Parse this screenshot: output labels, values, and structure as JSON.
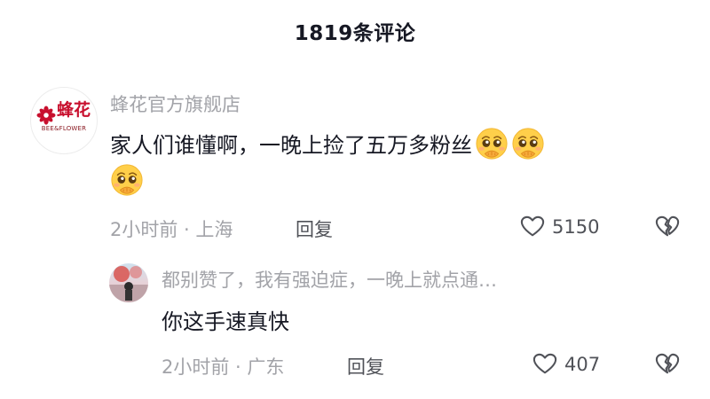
{
  "header": {
    "title": "1819条评论"
  },
  "comment": {
    "brand_logo": {
      "text": "蜂花",
      "subtext": "BEE&FLOWER"
    },
    "username": "蜂花官方旗舰店",
    "text": "家人们谁懂啊，一晚上捡了五万多粉丝",
    "emojis": [
      "pleading-face-emoji",
      "pleading-face-emoji",
      "pleading-face-emoji"
    ],
    "time_location": "2小时前 · 上海",
    "reply_label": "回复",
    "like_count": "5150",
    "icons": {
      "like": "heart-outline-icon",
      "dislike": "broken-heart-icon"
    }
  },
  "reply": {
    "username": "都别赞了，我有强迫症，一晚上就点通…",
    "text": "你这手速真快",
    "time_location": "2小时前 · 广东",
    "reply_label": "回复",
    "like_count": "407",
    "icons": {
      "like": "heart-outline-icon",
      "dislike": "broken-heart-icon"
    }
  },
  "colors": {
    "primary_text": "#161823",
    "secondary_text": "#a2a3a8",
    "brand_red": "#c8102e"
  }
}
